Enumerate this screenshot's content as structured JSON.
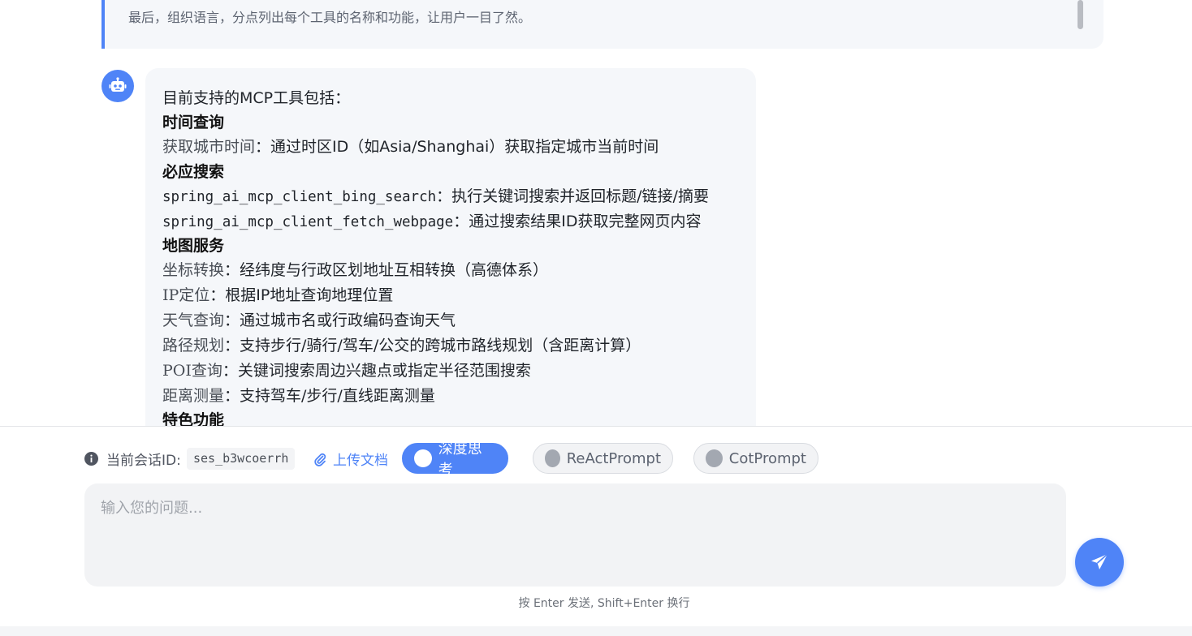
{
  "thinking": {
    "text": "最后，组织语言，分点列出每个工具的名称和功能，让用户一目了然。"
  },
  "message": {
    "intro": "目前支持的MCP工具包括：",
    "sections": [
      {
        "heading": "时间查询",
        "items": [
          {
            "name": "获取城市时间",
            "desc": "：通过时区ID（如Asia/Shanghai）获取指定城市当前时间"
          }
        ]
      },
      {
        "heading": "必应搜索",
        "items": [
          {
            "name": "spring_ai_mcp_client_bing_search",
            "desc": "：执行关键词搜索并返回标题/链接/摘要"
          },
          {
            "name": "spring_ai_mcp_client_fetch_webpage",
            "desc": "：通过搜索结果ID获取完整网页内容"
          }
        ]
      },
      {
        "heading": "地图服务",
        "items": [
          {
            "name": "坐标转换",
            "desc": "：经纬度与行政区划地址互相转换（高德体系）"
          },
          {
            "name": "IP定位",
            "desc": "：根据IP地址查询地理位置"
          },
          {
            "name": "天气查询",
            "desc": "：通过城市名或行政编码查询天气"
          },
          {
            "name": "路径规划",
            "desc": "：支持步行/骑行/驾车/公交的跨城市路线规划（含距离计算）"
          },
          {
            "name": "POI查询",
            "desc": "：关键词搜索周边兴趣点或指定半径范围搜索"
          },
          {
            "name": "距离测量",
            "desc": "：支持驾车/步行/直线距离测量"
          }
        ]
      },
      {
        "heading": "特色功能",
        "items": []
      }
    ]
  },
  "toolbar": {
    "session_label": "当前会话ID:",
    "session_id": "ses_b3wcoerrh",
    "upload_label": "上传文档",
    "deep_think_label": "深度思考",
    "react_label": "ReActPrompt",
    "cot_label": "CotPrompt"
  },
  "input": {
    "placeholder": "输入您的问题..."
  },
  "hint": "按 Enter 发送, Shift+Enter 换行",
  "colors": {
    "accent": "#4f84f7",
    "bubble_bg": "#f5f7fa"
  },
  "icons": {
    "avatar": "robot-icon",
    "info": "info-icon",
    "upload": "paperclip-icon",
    "send": "paper-plane-icon"
  }
}
